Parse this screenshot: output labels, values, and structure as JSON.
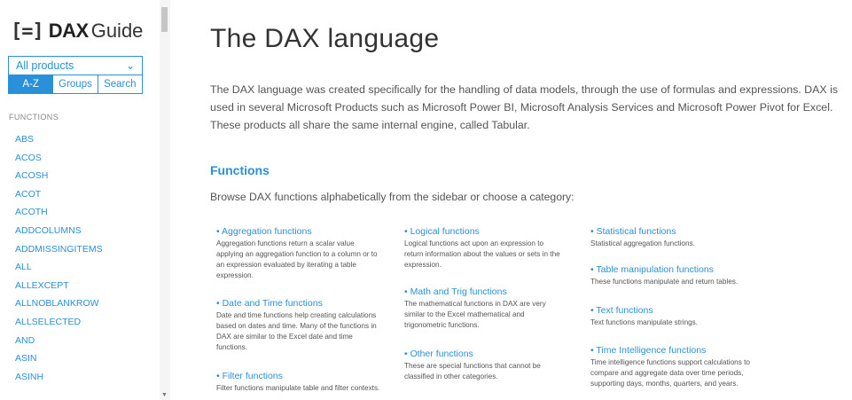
{
  "logo": {
    "mark": "[=]",
    "dax": "DAX",
    "guide": "Guide"
  },
  "sidebar": {
    "product_select": "All products",
    "tabs": [
      {
        "label": "A-Z",
        "active": true
      },
      {
        "label": "Groups",
        "active": false
      },
      {
        "label": "Search",
        "active": false
      }
    ],
    "functions_heading": "FUNCTIONS",
    "functions": [
      "ABS",
      "ACOS",
      "ACOSH",
      "ACOT",
      "ACOTH",
      "ADDCOLUMNS",
      "ADDMISSINGITEMS",
      "ALL",
      "ALLEXCEPT",
      "ALLNOBLANKROW",
      "ALLSELECTED",
      "AND",
      "ASIN",
      "ASINH"
    ]
  },
  "main": {
    "title": "The DAX language",
    "intro": "The DAX language was created specifically for the handling of data models, through the use of formulas and expressions. DAX is used in several Microsoft Products such as Microsoft Power BI, Microsoft Analysis Services and Microsoft Power Pivot for Excel. These products all share the same internal engine, called Tabular.",
    "functions_title": "Functions",
    "functions_desc": "Browse DAX functions alphabetically from the sidebar or choose a category:",
    "categories": [
      {
        "title": "• Aggregation functions",
        "desc": "Aggregation functions return a scalar value applying an aggregation function to a column or to an expression evaluated by iterating a table expression."
      },
      {
        "title": "• Date and Time functions",
        "desc": "Date and time functions help creating calculations based on dates and time. Many of the functions in DAX are similar to the Excel date and time functions."
      },
      {
        "title": "• Filter functions",
        "desc": "Filter functions manipulate table and filter contexts."
      },
      {
        "title": "• Logical functions",
        "desc": "Logical functions act upon an expression to return information about the values or sets in the expression."
      },
      {
        "title": "• Math and Trig functions",
        "desc": "The mathematical functions in DAX are very similar to the Excel mathematical and trigonometric functions."
      },
      {
        "title": "• Other functions",
        "desc": "These are special functions that cannot be classified in other categories."
      },
      {
        "title": "• Statistical functions",
        "desc": "Statistical aggregation functions."
      },
      {
        "title": "• Table manipulation functions",
        "desc": "These functions manipulate and return tables."
      },
      {
        "title": "• Text functions",
        "desc": "Text functions manipulate strings."
      },
      {
        "title": "• Time Intelligence functions",
        "desc": "Time intelligence functions support calculations to compare and aggregate data over time periods, supporting days, months, quarters, and years."
      }
    ]
  }
}
